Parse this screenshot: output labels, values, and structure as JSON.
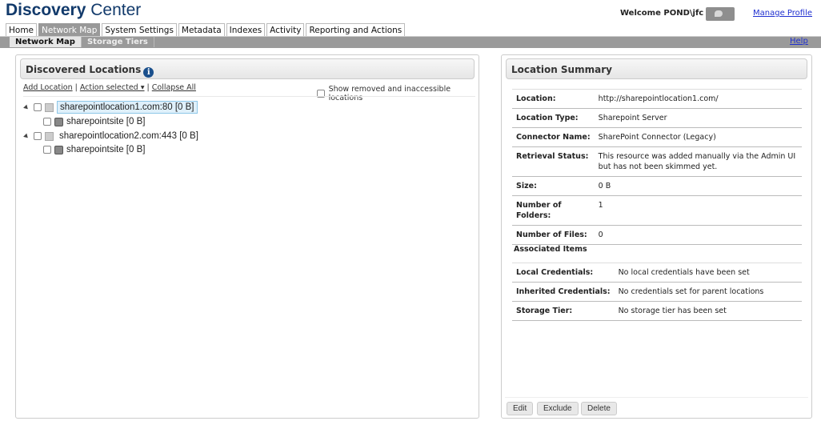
{
  "app": {
    "logo_bold": "Discovery",
    "logo_light": " Center",
    "welcome": "Welcome POND\\jfc",
    "manage_profile": "Manage Profile",
    "help": "Help"
  },
  "tabs": [
    "Home",
    "Network Map",
    "System Settings",
    "Metadata",
    "Indexes",
    "Activity",
    "Reporting and Actions"
  ],
  "subtabs": [
    "Network Map",
    "Storage Tiers"
  ],
  "left": {
    "title": "Discovered Locations",
    "add_location": "Add Location",
    "action_selected": "Action selected ▾",
    "collapse_all": "Collapse All",
    "show_removed": "Show removed and inaccessible locations",
    "tree": [
      {
        "label": "sharepointlocation1.com:80 [0 B]",
        "child": "sharepointsite [0 B]"
      },
      {
        "label": "sharepointlocation2.com:443 [0 B]",
        "child": "sharepointsite [0 B]"
      }
    ]
  },
  "right": {
    "title": "Location Summary",
    "rows": [
      [
        "Location:",
        "http://sharepointlocation1.com/"
      ],
      [
        "Location Type:",
        "Sharepoint Server"
      ],
      [
        "Connector Name:",
        "SharePoint Connector (Legacy)"
      ],
      [
        "Retrieval Status:",
        "This resource was added manually via the Admin UI but has not been skimmed yet."
      ],
      [
        "Size:",
        "0 B"
      ],
      [
        "Number of Folders:",
        "1"
      ],
      [
        "Number of Files:",
        "0"
      ]
    ],
    "associated_title": "Associated Items",
    "assoc": [
      [
        "Local Credentials:",
        "No local credentials have been set"
      ],
      [
        "Inherited Credentials:",
        "No credentials set for parent locations"
      ],
      [
        "Storage Tier:",
        "No storage tier has been set"
      ]
    ],
    "buttons": [
      "Edit",
      "Exclude",
      "Delete"
    ]
  }
}
